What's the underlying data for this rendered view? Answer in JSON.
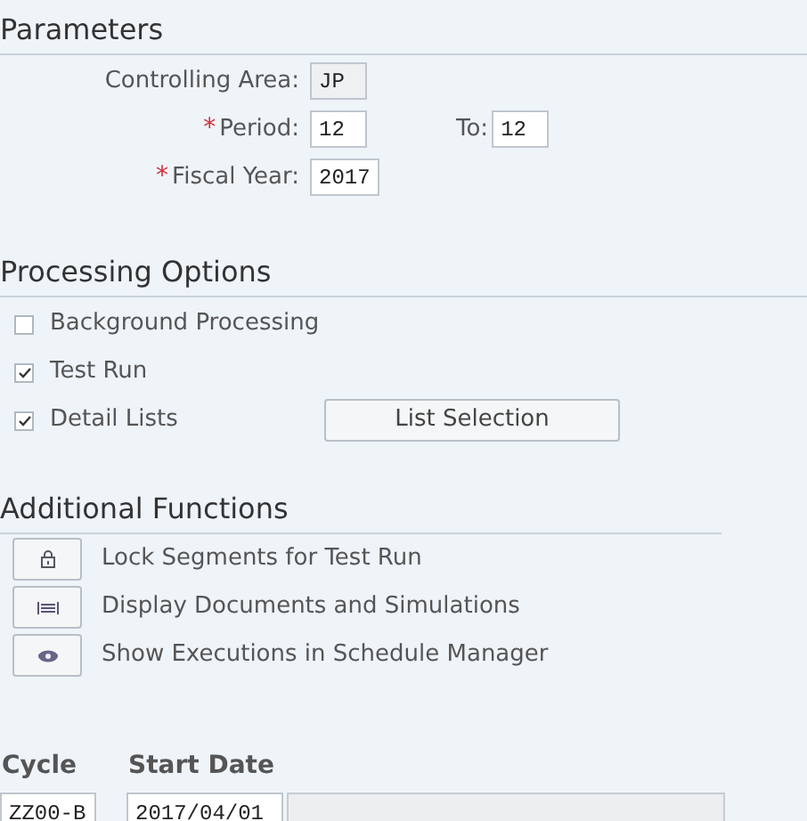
{
  "parameters": {
    "title": "Parameters",
    "fields": [
      {
        "label": "Controlling Area:",
        "value": "JP",
        "disabled": true
      },
      {
        "label": "Period:",
        "required_mark": "*",
        "value": "12",
        "disabled": false,
        "to": {
          "label": "To:",
          "value": "12"
        }
      },
      {
        "label": "Fiscal Year:",
        "required_mark": "*",
        "value": "2017",
        "disabled": false
      }
    ]
  },
  "processing_options": {
    "title": "Processing Options",
    "options": [
      {
        "label": "Background Processing",
        "checked": false
      },
      {
        "label": "Test Run",
        "checked": true
      },
      {
        "label": "Detail Lists",
        "checked": true,
        "button": "List Selection"
      }
    ]
  },
  "additional_functions": {
    "title": "Additional Functions",
    "items": [
      {
        "kind": "lock",
        "label": "Lock Segments for Test Run"
      },
      {
        "kind": "documents",
        "label": "Display Documents and Simulations"
      },
      {
        "kind": "eye",
        "label": "Show Executions in Schedule Manager"
      }
    ]
  },
  "table": {
    "columns": [
      "Cycle",
      "Start Date"
    ],
    "rows": [
      [
        "ZZ00-B",
        "2017/04/01"
      ]
    ]
  }
}
